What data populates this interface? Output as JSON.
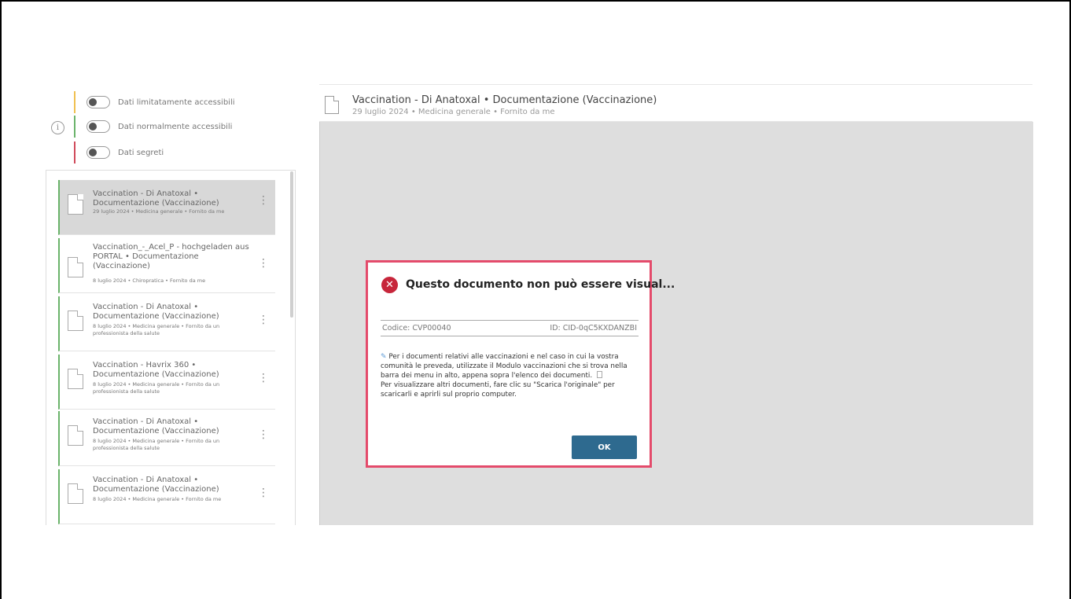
{
  "filters": [
    {
      "label": "Dati limitatamente accessibili",
      "color": "#f0c050"
    },
    {
      "label": "Dati normalmente accessibili",
      "color": "#6ab36a"
    },
    {
      "label": "Dati segreti",
      "color": "#d04a5a"
    }
  ],
  "info_icon": "i",
  "documents": [
    {
      "title": "Vaccination - Di Anatoxal • Documentazione (Vaccinazione)",
      "meta": "29 luglio 2024 • Medicina generale • Fornito da me",
      "active": true
    },
    {
      "title": "Vaccination_-_Acel_P - hochgeladen aus PORTAL • Documentazione (Vaccinazione)",
      "meta": "8 luglio 2024 • Chiropratica • Fornito da me"
    },
    {
      "title": "Vaccination - Di Anatoxal • Documentazione (Vaccinazione)",
      "meta": "8 luglio 2024 • Medicina generale • Fornito da un professionista della salute"
    },
    {
      "title": "Vaccination - Havrix 360 • Documentazione (Vaccinazione)",
      "meta": "8 luglio 2024 • Medicina generale • Fornito da un professionista della salute"
    },
    {
      "title": "Vaccination - Di Anatoxal • Documentazione (Vaccinazione)",
      "meta": "8 luglio 2024 • Medicina generale • Fornito da un professionista della salute"
    },
    {
      "title": "Vaccination - Di Anatoxal • Documentazione (Vaccinazione)",
      "meta": "8 luglio 2024 • Medicina generale • Fornito da me"
    }
  ],
  "viewer": {
    "title": "Vaccination - Di Anatoxal • Documentazione (Vaccinazione)",
    "subtitle": "29 luglio 2024 • Medicina generale • Fornito da me"
  },
  "modal": {
    "title": "Questo documento non può essere visual...",
    "code": "Codice: CVP00040",
    "id": "ID: CID-0qC5KXDANZBI",
    "text": "Per i documenti relativi alle vaccinazioni e nel caso in cui la vostra comunità le preveda, utilizzate il Modulo vaccinazioni che si trova nella barra dei menu in alto, appena sopra l'elenco dei documenti.",
    "text2": "Per visualizzare altri documenti, fare clic su \"Scarica l'originale\" per scaricarli e aprirli sul proprio computer.",
    "ok_label": "OK",
    "border_color": "#e44b6b",
    "button_color": "#2e6a8f"
  }
}
